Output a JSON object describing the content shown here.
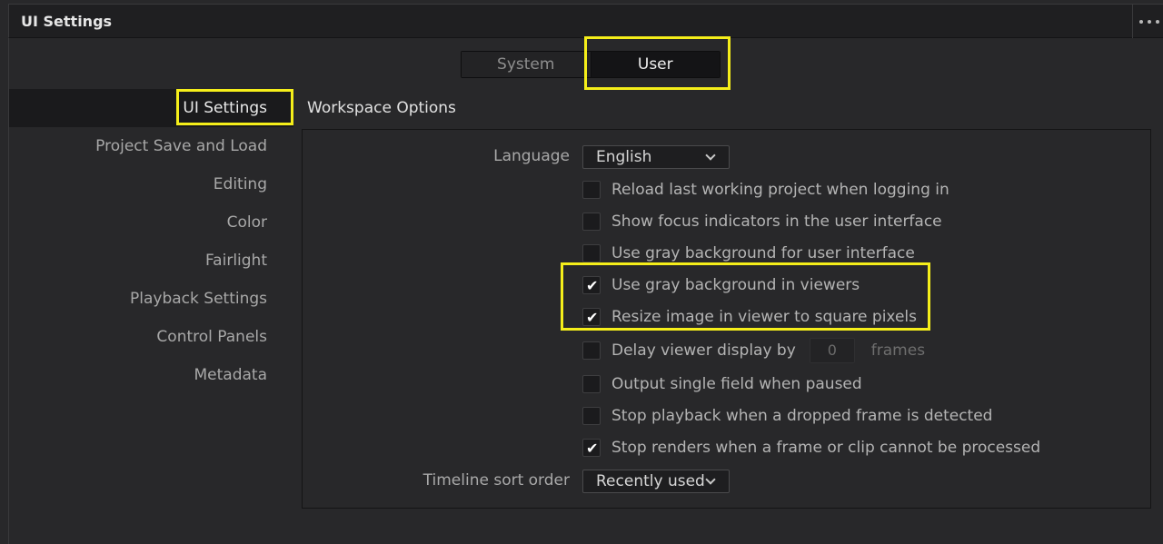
{
  "window": {
    "title": "UI Settings",
    "more_icon": "more-horizontal-icon"
  },
  "tabs": [
    {
      "label": "System",
      "selected": false
    },
    {
      "label": "User",
      "selected": true
    }
  ],
  "sidebar": {
    "items": [
      {
        "label": "UI Settings",
        "active": true
      },
      {
        "label": "Project Save and Load",
        "active": false
      },
      {
        "label": "Editing",
        "active": false
      },
      {
        "label": "Color",
        "active": false
      },
      {
        "label": "Fairlight",
        "active": false
      },
      {
        "label": "Playback Settings",
        "active": false
      },
      {
        "label": "Control Panels",
        "active": false
      },
      {
        "label": "Metadata",
        "active": false
      }
    ]
  },
  "section": {
    "title": "Workspace Options"
  },
  "language": {
    "label": "Language",
    "value": "English"
  },
  "options": [
    {
      "label": "Reload last working project when logging in",
      "checked": false
    },
    {
      "label": "Show focus indicators in the user interface",
      "checked": false
    },
    {
      "label": "Use gray background for user interface",
      "checked": false
    },
    {
      "label": "Use gray background in viewers",
      "checked": true
    },
    {
      "label": "Resize image in viewer to square pixels",
      "checked": true
    },
    {
      "label": "Delay viewer display by",
      "checked": false,
      "value": "0",
      "unit": "frames"
    },
    {
      "label": "Output single field when paused",
      "checked": false
    },
    {
      "label": "Stop playback when a dropped frame is detected",
      "checked": false
    },
    {
      "label": "Stop renders when a frame or clip cannot be processed",
      "checked": true
    }
  ],
  "timeline_sort": {
    "label": "Timeline sort order",
    "value": "Recently used"
  },
  "colors": {
    "highlight": "#f5ee1a",
    "background": "#28282a",
    "panel_dark": "#1f1f21"
  }
}
